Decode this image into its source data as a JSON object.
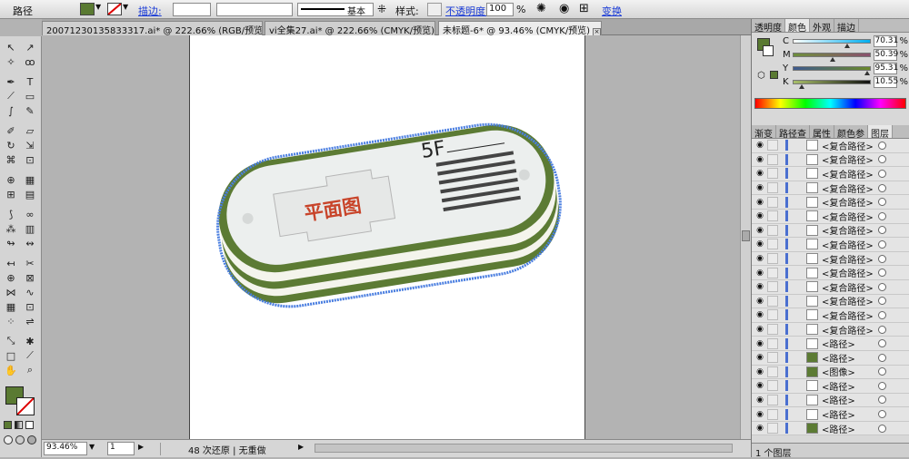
{
  "control_bar": {
    "object_type": "路径",
    "stroke_label": "描边:",
    "stroke_profile": "基本",
    "style_label": "样式:",
    "opacity_label": "不透明度:",
    "opacity_value": "100",
    "opacity_unit": "%",
    "transform_label": "变换",
    "fill_color": "#5a7a32"
  },
  "doc_tabs": [
    {
      "label": "20071230135833317.ai* @ 222.66% (RGB/预览)"
    },
    {
      "label": "vi全集27.ai* @ 222.66% (CMYK/预览)"
    },
    {
      "label": "未标题-6* @ 93.46% (CMYK/预览)"
    }
  ],
  "artwork": {
    "floor_label": "5F",
    "map_label": "平面图",
    "green": "#5c7b34",
    "label_red": "#c8442a",
    "selection_blue": "#4a7ee0"
  },
  "status_bar": {
    "zoom": "93.46%",
    "page": "1",
    "history": "48 次还原 | 无重做"
  },
  "color_panel": {
    "tabs": [
      "透明度",
      "颜色",
      "外观",
      "描边"
    ],
    "active_tab": "颜色",
    "channels": [
      {
        "name": "C",
        "value": "70.31",
        "pct": 70.31
      },
      {
        "name": "M",
        "value": "50.39",
        "pct": 50.39
      },
      {
        "name": "Y",
        "value": "95.31",
        "pct": 95.31
      },
      {
        "name": "K",
        "value": "10.55",
        "pct": 10.55
      }
    ],
    "unit": "%"
  },
  "layers_panel": {
    "tabs": [
      "渐变",
      "路径查",
      "属性",
      "颜色参",
      "图层"
    ],
    "active_tab": "图层",
    "rows": [
      {
        "name": "<复合路径>"
      },
      {
        "name": "<复合路径>"
      },
      {
        "name": "<复合路径>"
      },
      {
        "name": "<复合路径>"
      },
      {
        "name": "<复合路径>"
      },
      {
        "name": "<复合路径>"
      },
      {
        "name": "<复合路径>"
      },
      {
        "name": "<复合路径>"
      },
      {
        "name": "<复合路径>"
      },
      {
        "name": "<复合路径>"
      },
      {
        "name": "<复合路径>"
      },
      {
        "name": "<复合路径>"
      },
      {
        "name": "<复合路径>"
      },
      {
        "name": "<复合路径>"
      },
      {
        "name": "<路径>"
      },
      {
        "name": "<路径>"
      },
      {
        "name": "<图像>"
      },
      {
        "name": "<路径>"
      },
      {
        "name": "<路径>"
      },
      {
        "name": "<路径>"
      },
      {
        "name": "<路径>"
      }
    ],
    "footer": "1 个图层"
  }
}
